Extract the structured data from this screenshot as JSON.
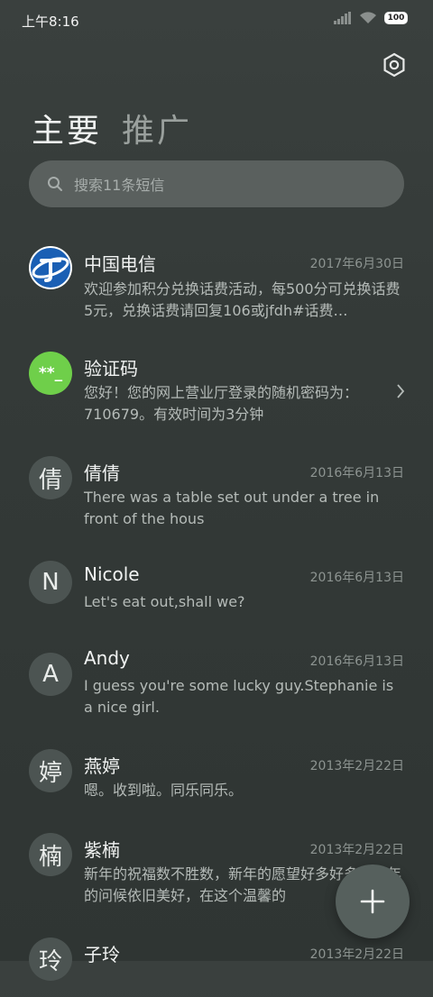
{
  "status_bar": {
    "time": "上午8:16",
    "battery": "100"
  },
  "tabs": [
    {
      "label": "主要"
    },
    {
      "label": "推广"
    }
  ],
  "search": {
    "placeholder": "搜索11条短信"
  },
  "conversations": [
    {
      "name": "中国电信",
      "date": "2017年6月30日",
      "avatar_text": "",
      "avatar_type": "logo",
      "preview": "欢迎参加积分兑换话费活动，每500分可兑换话费5元，兑换话费请回复106或jfdh#话费…"
    },
    {
      "name": "验证码",
      "date": "",
      "avatar_text": "**_",
      "avatar_type": "code",
      "preview": "您好！您的网上营业厅登录的随机密码为：710679。有效时间为3分钟"
    },
    {
      "name": "倩倩",
      "date": "2016年6月13日",
      "avatar_text": "倩",
      "preview": "There was a table set out under a tree in front of the hous"
    },
    {
      "name": "Nicole",
      "date": "2016年6月13日",
      "avatar_text": "N",
      "preview": "Let's eat out,shall we?"
    },
    {
      "name": "Andy",
      "date": "2016年6月13日",
      "avatar_text": "A",
      "preview": "I guess you're some lucky guy.Stephanie is a nice girl."
    },
    {
      "name": "燕婷",
      "date": "2013年2月22日",
      "avatar_text": "婷",
      "preview": "嗯。收到啦。同乐同乐。"
    },
    {
      "name": "紫楠",
      "date": "2013年2月22日",
      "avatar_text": "楠",
      "preview": "新年的祝福数不胜数，新年的愿望好多好多，新年的问候依旧美好，在这个温馨的"
    },
    {
      "name": "子玲",
      "date": "2013年2月22日",
      "avatar_text": "玲",
      "preview": ""
    }
  ],
  "colors": {
    "telecom_blue": "#1a5fb4",
    "code_green": "#6fcf4a"
  }
}
